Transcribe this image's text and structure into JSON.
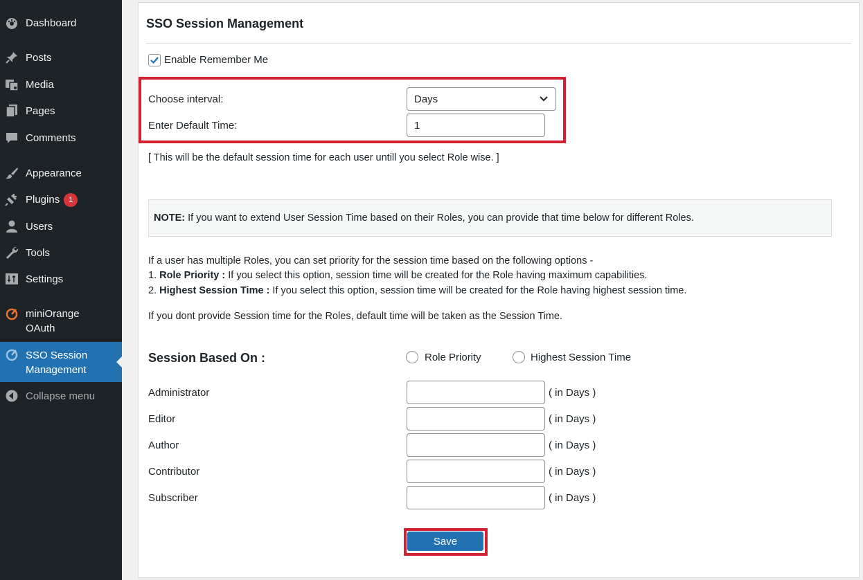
{
  "sidebar": {
    "items": [
      {
        "label": "Dashboard",
        "icon": "dashboard-icon"
      },
      {
        "label": "Posts",
        "icon": "pin-icon"
      },
      {
        "label": "Media",
        "icon": "media-icon"
      },
      {
        "label": "Pages",
        "icon": "pages-icon"
      },
      {
        "label": "Comments",
        "icon": "comment-icon"
      },
      {
        "label": "Appearance",
        "icon": "brush-icon"
      },
      {
        "label": "Plugins",
        "icon": "plugin-icon",
        "badge": "1"
      },
      {
        "label": "Users",
        "icon": "user-icon"
      },
      {
        "label": "Tools",
        "icon": "wrench-icon"
      },
      {
        "label": "Settings",
        "icon": "settings-icon"
      },
      {
        "label_line1": "miniOrange",
        "label_line2": "OAuth",
        "icon": "miniorange-icon"
      },
      {
        "label_line1": "SSO Session",
        "label_line2": "Management",
        "icon": "miniorange-icon"
      },
      {
        "label": "Collapse menu",
        "icon": "collapse-arrow-icon"
      }
    ]
  },
  "panel": {
    "title": "SSO Session Management",
    "remember_me_label": "Enable Remember Me",
    "remember_me_checked": true,
    "interval_label": "Choose interval:",
    "interval_value": "Days",
    "default_time_label": "Enter Default Time:",
    "default_time_value": "1",
    "default_hint": "[ This will be the default session time for each user untill you select Role wise. ]",
    "note_bold": "NOTE:",
    "note_text": " If you want to extend User Session Time based on their Roles, you can provide that time below for different Roles.",
    "priority_intro": "If a user has multiple Roles, you can set priority for the session time based on the following options -",
    "option1_prefix": "1. ",
    "option1_bold": "Role Priority :",
    "option1_text": " If you select this option, session time will be created for the Role having maximum capabilities.",
    "option2_prefix": "2. ",
    "option2_bold": "Highest Session Time :",
    "option2_text": " If you select this option, session time will be created for the Role having highest session time.",
    "fallback_text": "If you dont provide Session time for the Roles, default time will be taken as the Session Time.",
    "session_based_label": "Session Based On :",
    "radio_role_priority": "Role Priority",
    "radio_highest": "Highest Session Time",
    "unit_suffix": "( in Days )",
    "roles": [
      "Administrator",
      "Editor",
      "Author",
      "Contributor",
      "Subscriber"
    ],
    "save_label": "Save"
  },
  "colors": {
    "sidebar_bg": "#1d2327",
    "active_bg": "#2271b1",
    "highlight_red": "#d42131",
    "badge_red": "#d63638",
    "miniorange_orange": "#e8722a"
  }
}
